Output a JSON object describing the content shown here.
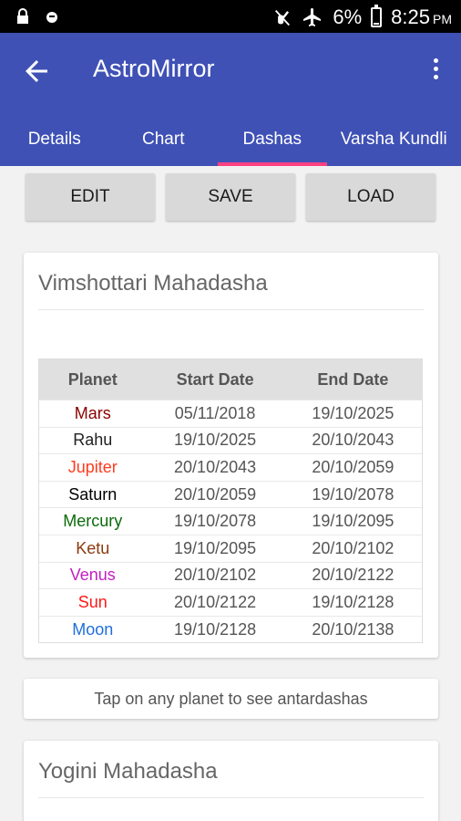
{
  "status_bar": {
    "icons": [
      "lock-icon",
      "debug-icon",
      "mute-icon",
      "airplane-icon",
      "battery-icon"
    ],
    "battery": "6%",
    "battery_level": 0.06,
    "time": "8:25",
    "ampm": "PM"
  },
  "app_bar": {
    "title": "AstroMirror",
    "back_icon": "arrow-back-icon",
    "menu_icon": "more-vert-icon"
  },
  "tabs": [
    {
      "label": "Details"
    },
    {
      "label": "Chart"
    },
    {
      "label": "Dashas",
      "active": true
    },
    {
      "label": "Varsha Kundli"
    }
  ],
  "actions": {
    "edit": "EDIT",
    "save": "SAVE",
    "load": "LOAD"
  },
  "vimshottari": {
    "title": "Vimshottari Mahadasha",
    "headers": {
      "planet": "Planet",
      "start": "Start Date",
      "end": "End Date"
    },
    "rows": [
      {
        "planet": "Mars",
        "color": "#8b0000",
        "start": "05/11/2018",
        "end": "19/10/2025"
      },
      {
        "planet": "Rahu",
        "color": "#222222",
        "start": "19/10/2025",
        "end": "20/10/2043"
      },
      {
        "planet": "Jupiter",
        "color": "#ff3b1f",
        "start": "20/10/2043",
        "end": "20/10/2059"
      },
      {
        "planet": "Saturn",
        "color": "#000000",
        "start": "20/10/2059",
        "end": "19/10/2078"
      },
      {
        "planet": "Mercury",
        "color": "#0a6b0a",
        "start": "19/10/2078",
        "end": "19/10/2095"
      },
      {
        "planet": "Ketu",
        "color": "#8b3a0f",
        "start": "19/10/2095",
        "end": "20/10/2102"
      },
      {
        "planet": "Venus",
        "color": "#c21fc2",
        "start": "20/10/2102",
        "end": "20/10/2122"
      },
      {
        "planet": "Sun",
        "color": "#ff1a1a",
        "start": "20/10/2122",
        "end": "19/10/2128"
      },
      {
        "planet": "Moon",
        "color": "#1e6fd9",
        "start": "19/10/2128",
        "end": "20/10/2138"
      }
    ]
  },
  "hint": "Tap on any planet to see antardashas",
  "yogini": {
    "title": "Yogini Mahadasha"
  },
  "colors": {
    "primary": "#3f51b5",
    "accent": "#ff4081"
  }
}
